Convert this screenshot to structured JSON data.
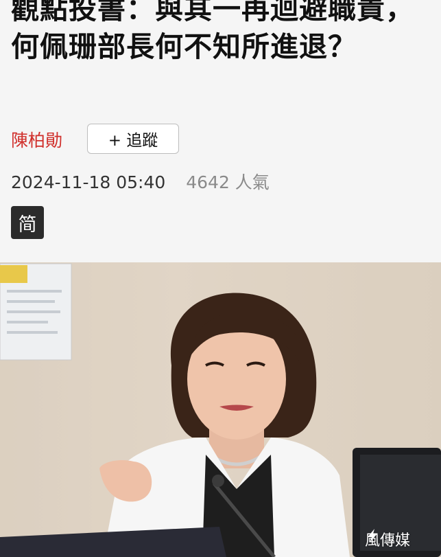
{
  "article": {
    "headline": "觀點投書：與其一再迴避職責，何佩珊部長何不知所進退？",
    "author": "陳柏勛",
    "follow_label": "+ 追蹤",
    "date": "2024-11-18 05:40",
    "views": "4642 人氣",
    "simplified_toggle": "简"
  },
  "photo": {
    "watermark": "風傳媒"
  }
}
